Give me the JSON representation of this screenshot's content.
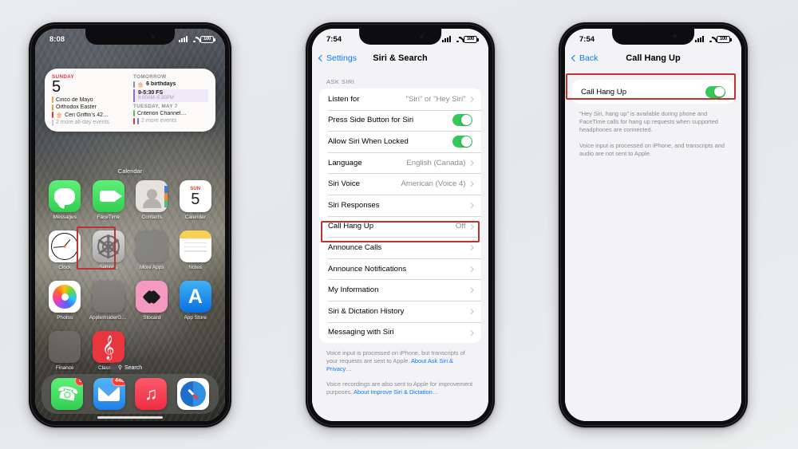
{
  "background_color": "#e8eaec",
  "accent": {
    "highlight_red": "#c0322c",
    "ios_blue": "#0a7cff",
    "toggle_green": "#34c759"
  },
  "phone1": {
    "name": "iPhone home screen",
    "status": {
      "time": "8:08",
      "battery": "100"
    },
    "widget": {
      "left": {
        "header": "SUNDAY",
        "day": "5",
        "events": [
          {
            "text": "Cinco de Mayo",
            "color": "#e8a33d",
            "icon": ""
          },
          {
            "text": "Orthodox Easter",
            "color": "#e8a33d",
            "icon": ""
          },
          {
            "text": "Ceri Griffin's 42…",
            "color": "#e0353a",
            "icon": "🎂"
          },
          {
            "text": "2 more all-day events",
            "color": "#b9b9c2",
            "icon": ""
          }
        ]
      },
      "right": {
        "header": "TOMORROW",
        "birthday": "6 birthdays",
        "birthday_icon": "🎂",
        "block_title": "9-5:30 FS",
        "block_time": "9:00AM–5:30PM",
        "header2": "TUESDAY, MAY 7",
        "event2": "Criterion Channel…",
        "more2": "2 more events"
      },
      "label": "Calendar"
    },
    "apps": [
      {
        "name": "Messages",
        "icon": "messages-icon"
      },
      {
        "name": "FaceTime",
        "icon": "facetime-icon"
      },
      {
        "name": "Contacts",
        "icon": "contacts-icon"
      },
      {
        "name": "Calendar",
        "icon": "calendar-icon",
        "cal_dow": "SUN",
        "cal_day": "5"
      },
      {
        "name": "Clock",
        "icon": "clock-icon"
      },
      {
        "name": "Settings",
        "icon": "settings-icon"
      },
      {
        "name": "More Apps",
        "icon": "folder-icon"
      },
      {
        "name": "Notes",
        "icon": "notes-icon"
      },
      {
        "name": "Photos",
        "icon": "photos-icon"
      },
      {
        "name": "AppleInsiderGr…",
        "icon": "folder-icon"
      },
      {
        "name": "Stocard",
        "icon": "stocard-icon"
      },
      {
        "name": "App Store",
        "icon": "appstore-icon"
      },
      {
        "name": "Finance",
        "icon": "finance-folder-icon"
      },
      {
        "name": "Classical",
        "icon": "classical-icon"
      }
    ],
    "search_pill": "Search",
    "dock": [
      {
        "name": "Phone",
        "icon": "phone-icon",
        "badge": "5"
      },
      {
        "name": "Mail",
        "icon": "mail-icon",
        "badge": "448"
      },
      {
        "name": "Music",
        "icon": "music-icon",
        "badge": ""
      },
      {
        "name": "Safari",
        "icon": "safari-icon",
        "badge": ""
      }
    ]
  },
  "phone2": {
    "name": "Siri & Search settings",
    "status": {
      "time": "7:54",
      "battery": "100"
    },
    "nav": {
      "back": "Settings",
      "title": "Siri & Search"
    },
    "group_header": "ASK SIRI",
    "rows": [
      {
        "label": "Listen for",
        "value": "\"Siri\" or \"Hey Siri\"",
        "type": "chevron"
      },
      {
        "label": "Press Side Button for Siri",
        "value": "",
        "type": "toggle_on"
      },
      {
        "label": "Allow Siri When Locked",
        "value": "",
        "type": "toggle_on"
      },
      {
        "label": "Language",
        "value": "English (Canada)",
        "type": "chevron"
      },
      {
        "label": "Siri Voice",
        "value": "American (Voice 4)",
        "type": "chevron"
      },
      {
        "label": "Siri Responses",
        "value": "",
        "type": "chevron"
      },
      {
        "label": "Call Hang Up",
        "value": "Off",
        "type": "chevron",
        "highlighted": true
      },
      {
        "label": "Announce Calls",
        "value": "",
        "type": "chevron"
      },
      {
        "label": "Announce Notifications",
        "value": "",
        "type": "chevron"
      },
      {
        "label": "My Information",
        "value": "",
        "type": "chevron"
      },
      {
        "label": "Siri & Dictation History",
        "value": "",
        "type": "chevron"
      },
      {
        "label": "Messaging with Siri",
        "value": "",
        "type": "chevron"
      }
    ],
    "footnote1_text": "Voice input is processed on iPhone, but transcripts of your requests are sent to Apple. ",
    "footnote1_link": "About Ask Siri & Privacy…",
    "footnote2_text": "Voice recordings are also sent to Apple for improvement purposes. ",
    "footnote2_link": "About Improve Siri & Dictation…"
  },
  "phone3": {
    "name": "Call Hang Up settings",
    "status": {
      "time": "7:54",
      "battery": "100"
    },
    "nav": {
      "back": "Back",
      "title": "Call Hang Up"
    },
    "row": {
      "label": "Call Hang Up",
      "type": "toggle_on"
    },
    "footnote1": "\"Hey Siri, hang up\" is available during phone and FaceTime calls for hang up requests when supported headphones are connected.",
    "footnote2": "Voice input is processed on iPhone, and transcripts and audio are not sent to Apple."
  }
}
